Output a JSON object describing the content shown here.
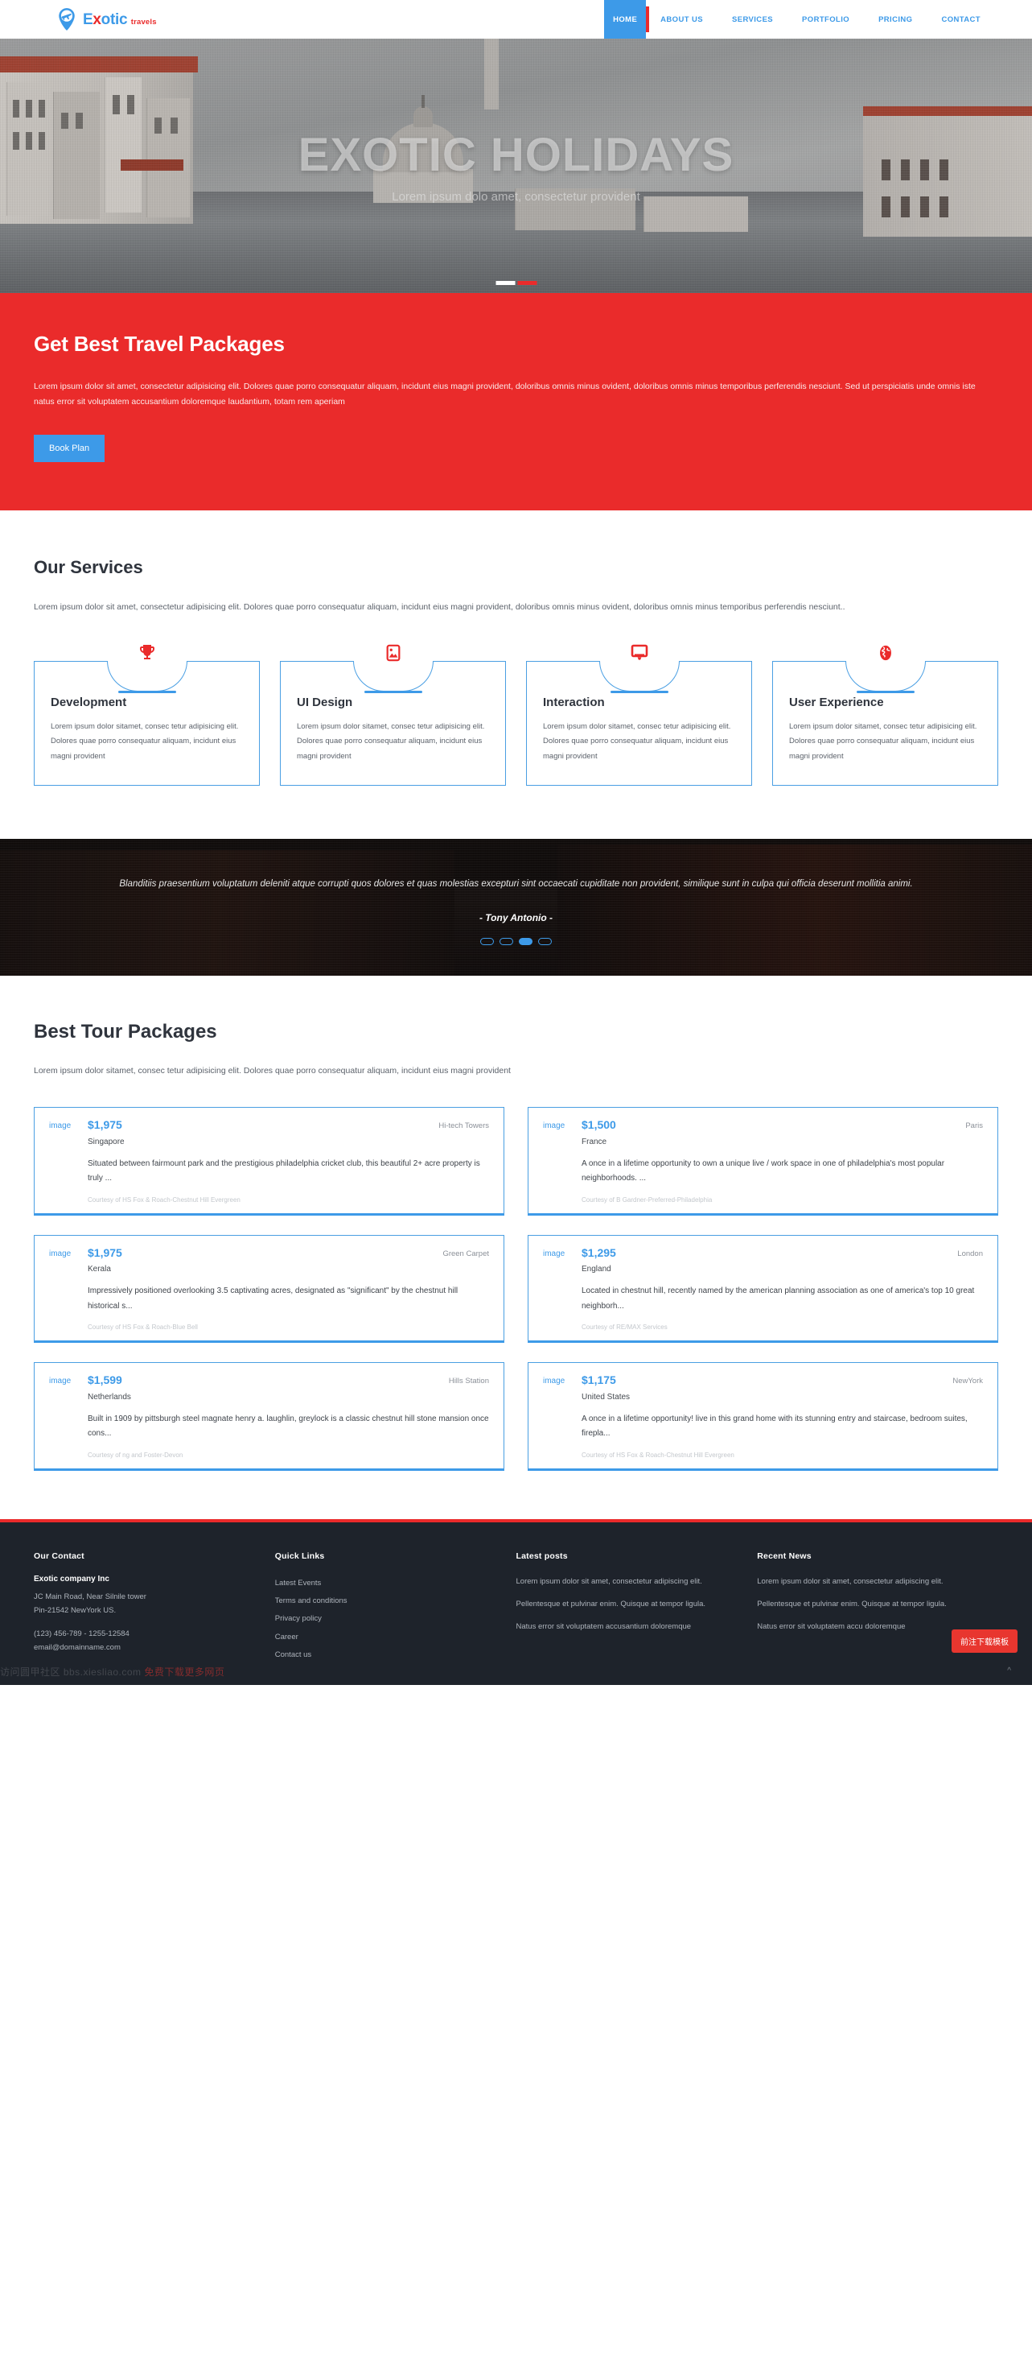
{
  "brand": {
    "name_part1": "E",
    "name_x": "x",
    "name_part2": "otic",
    "tagline": "travels",
    "pin_icon": "map-pin-plane-icon",
    "blue": "#3d9ae8",
    "red": "#ea2b2b"
  },
  "nav": {
    "items": [
      {
        "label": "HOME",
        "active": true
      },
      {
        "label": "ABOUT US",
        "active": false
      },
      {
        "label": "SERVICES",
        "active": false
      },
      {
        "label": "PORTFOLIO",
        "active": false
      },
      {
        "label": "PRICING",
        "active": false
      },
      {
        "label": "CONTACT",
        "active": false
      }
    ]
  },
  "hero": {
    "title": "EXOTIC HOLIDAYS",
    "subtitle": "Lorem ipsum dolo amet, consectetur provident",
    "slides": 2,
    "active_slide": 2
  },
  "cta": {
    "heading": "Get Best Travel Packages",
    "paragraph": "Lorem ipsum dolor sit amet, consectetur adipisicing elit. Dolores quae porro consequatur aliquam, incidunt eius magni provident, doloribus omnis minus ovident, doloribus omnis minus temporibus perferendis nesciunt. Sed ut perspiciatis unde omnis iste natus error sit voluptatem accusantium doloremque laudantium, totam rem aperiam",
    "button_label": "Book Plan",
    "bg": "#ea2b2b"
  },
  "services": {
    "heading": "Our Services",
    "lead": "Lorem ipsum dolor sit amet, consectetur adipisicing elit. Dolores quae porro consequatur aliquam, incidunt eius magni provident, doloribus omnis minus ovident, doloribus omnis minus temporibus perferendis nesciunt..",
    "cards": [
      {
        "icon": "trophy-icon",
        "title": "Development",
        "text": "Lorem ipsum dolor sitamet, consec tetur adipisicing elit. Dolores quae porro consequatur aliquam, incidunt eius magni provident"
      },
      {
        "icon": "image-icon",
        "title": "UI Design",
        "text": "Lorem ipsum dolor sitamet, consec tetur adipisicing elit. Dolores quae porro consequatur aliquam, incidunt eius magni provident"
      },
      {
        "icon": "monitor-icon",
        "title": "Interaction",
        "text": "Lorem ipsum dolor sitamet, consec tetur adipisicing elit. Dolores quae porro consequatur aliquam, incidunt eius magni provident"
      },
      {
        "icon": "globe-icon",
        "title": "User Experience",
        "text": "Lorem ipsum dolor sitamet, consec tetur adipisicing elit. Dolores quae porro consequatur aliquam, incidunt eius magni provident"
      }
    ]
  },
  "testimonial": {
    "quote": "Blanditiis praesentium voluptatum deleniti atque corrupti quos dolores et quas molestias excepturi sint occaecati cupiditate non provident, similique sunt in culpa qui officia deserunt mollitia animi.",
    "author": "- Tony Antonio -",
    "dots": 4,
    "active_dot": 3
  },
  "tours": {
    "heading": "Best Tour Packages",
    "lead": "Lorem ipsum dolor sitamet, consec tetur adipisicing elit. Dolores quae porro consequatur aliquam, incidunt eius magni provident",
    "thumb_label": "image",
    "items": [
      {
        "price": "$1,975",
        "region": "Hi-tech Towers",
        "country": "Singapore",
        "description": "Situated between fairmount park and the prestigious philadelphia cricket club, this beautiful 2+ acre property is truly ...",
        "courtesy": "Courtesy of HS Fox & Roach-Chestnut Hill Evergreen"
      },
      {
        "price": "$1,500",
        "region": "Paris",
        "country": "France",
        "description": "A once in a lifetime opportunity to own a unique live / work space in one of philadelphia's most popular neighborhoods. ...",
        "courtesy": "Courtesy of B Gardner-Preferred-Philadelphia"
      },
      {
        "price": "$1,975",
        "region": "Green Carpet",
        "country": "Kerala",
        "description": "Impressively positioned overlooking 3.5 captivating acres, designated as \"significant\" by the chestnut hill historical s...",
        "courtesy": "Courtesy of HS Fox & Roach-Blue Bell"
      },
      {
        "price": "$1,295",
        "region": "London",
        "country": "England",
        "description": "Located in chestnut hill, recently named by the american planning association as one of america's top 10 great neighborh...",
        "courtesy": "Courtesy of RE/MAX Services"
      },
      {
        "price": "$1,599",
        "region": "Hills Station",
        "country": "Netherlands",
        "description": "Built in 1909 by pittsburgh steel magnate henry a. laughlin, greylock is a classic chestnut hill stone mansion once cons...",
        "courtesy": "Courtesy of ng and Foster-Devon"
      },
      {
        "price": "$1,175",
        "region": "NewYork",
        "country": "United States",
        "description": "A once in a lifetime opportunity! live in this grand home with its stunning entry and staircase, bedroom suites, firepla...",
        "courtesy": "Courtesy of HS Fox & Roach-Chestnut Hill Evergreen"
      }
    ]
  },
  "footer": {
    "contact": {
      "heading": "Our Contact",
      "company": "Exotic company Inc",
      "address1": "JC Main Road, Near Silnile tower",
      "address2": "Pin-21542 NewYork US.",
      "phone": "(123) 456-789 - 1255-12584",
      "email": "email@domainname.com"
    },
    "quick_links": {
      "heading": "Quick Links",
      "items": [
        "Latest Events",
        "Terms and conditions",
        "Privacy policy",
        "Career",
        "Contact us"
      ]
    },
    "latest_posts": {
      "heading": "Latest posts",
      "items": [
        "Lorem ipsum dolor sit amet, consectetur adipiscing elit.",
        "Pellentesque et pulvinar enim. Quisque at tempor ligula.",
        "Natus error sit voluptatem accusantium doloremque"
      ]
    },
    "recent_news": {
      "heading": "Recent News",
      "items": [
        "Lorem ipsum dolor sit amet, consectetur adipiscing elit.",
        "Pellentesque et pulvinar enim. Quisque at tempor ligula.",
        "Natus error sit voluptatem accu doloremque"
      ]
    },
    "badge_label": "前注下载模板",
    "watermark_a": "访问圆甲社区 bbs.xiesliao.com ",
    "watermark_b": "免费下载更多网页",
    "caret": "^"
  }
}
